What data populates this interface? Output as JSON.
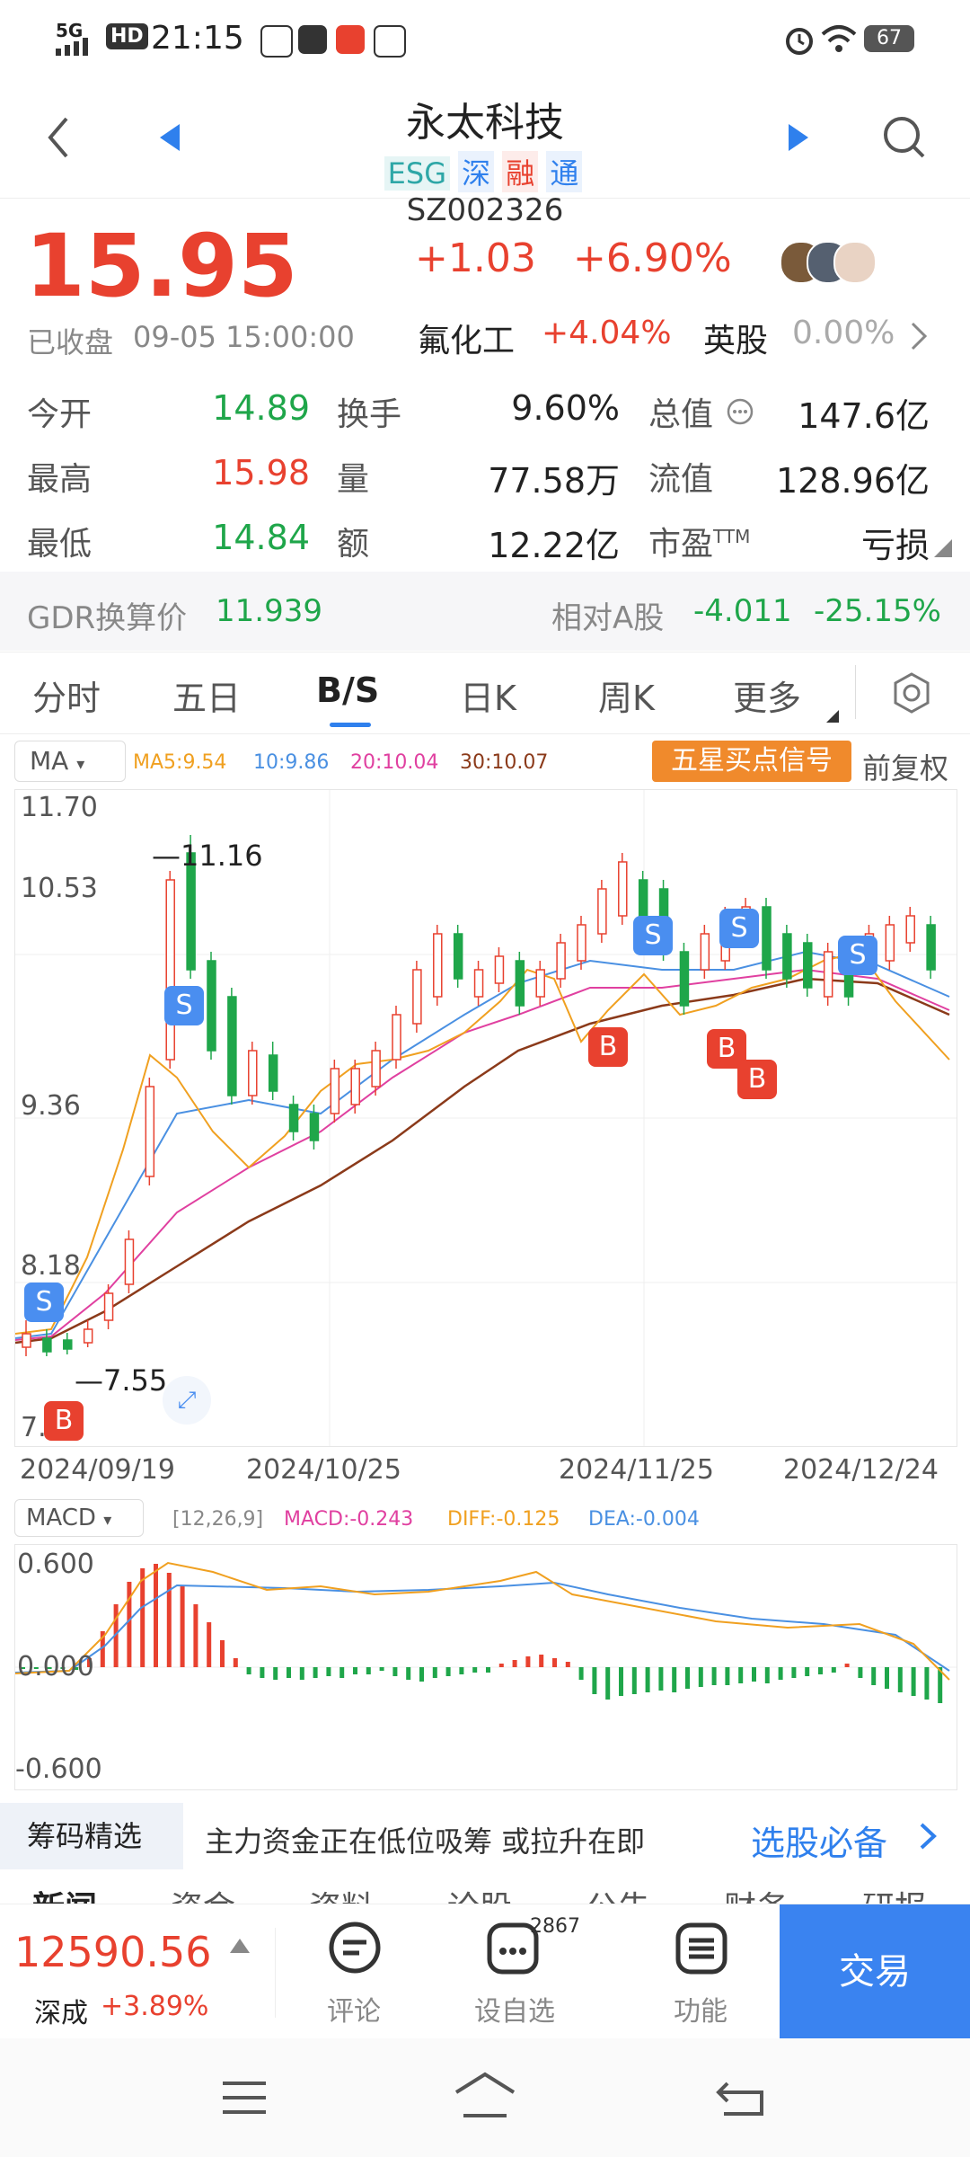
{
  "status": {
    "signal": "5G",
    "hd": "HD",
    "time": "21:15",
    "battery": "67"
  },
  "header": {
    "title": "永太科技",
    "tags": [
      "ESG",
      "深",
      "融",
      "通"
    ],
    "code": "SZ002326"
  },
  "quote": {
    "price": "15.95",
    "change": "+1.03",
    "change_pct": "+6.90%",
    "state": "已收盘",
    "datetime": "09-05  15:00:00",
    "sector_name": "氟化工",
    "sector_pct": "+4.04%",
    "uk_label": "英股",
    "uk_pct": "0.00%"
  },
  "metrics": {
    "open_label": "今开",
    "open": "14.89",
    "high_label": "最高",
    "high": "15.98",
    "low_label": "最低",
    "low": "14.84",
    "turnover_label": "换手",
    "turnover": "9.60%",
    "volume_label": "量",
    "volume": "77.58万",
    "amount_label": "额",
    "amount": "12.22亿",
    "mcap_label": "总值",
    "mcap": "147.6亿",
    "float_label": "流值",
    "float": "128.96亿",
    "pe_label": "市盈",
    "pe_sup": "TTM",
    "pe": "亏损"
  },
  "gdr": {
    "label": "GDR换算价",
    "value": "11.939",
    "rel_label": "相对A股",
    "rel_value": "-4.011",
    "rel_pct": "-25.15%"
  },
  "tabs": [
    "分时",
    "五日",
    "B/S",
    "日K",
    "周K",
    "更多"
  ],
  "active_tab": "B/S",
  "kline": {
    "indicator": "MA",
    "ma5": "MA5:9.54",
    "ma10": "10:9.86",
    "ma20": "20:10.04",
    "ma30": "30:10.07",
    "signal_btn": "五星买点信号",
    "adjust": "前复权",
    "y_labels": [
      "11.70",
      "10.53",
      "9.36",
      "8.18",
      "7.01"
    ],
    "x_labels": [
      "2024/09/19",
      "2024/10/25",
      "2024/11/25",
      "2024/12/24"
    ],
    "max_label": "11.16",
    "min_label": "7.55"
  },
  "macd": {
    "indicator": "MACD",
    "params": "[12,26,9]",
    "macd": "MACD:-0.243",
    "diff": "DIFF:-0.125",
    "dea": "DEA:-0.004",
    "y_labels": [
      "0.600",
      "0.000",
      "-0.600"
    ]
  },
  "chips": {
    "label": "筹码精选",
    "text": "主力资金正在低位吸筹  或拉升在即",
    "link": "选股必备"
  },
  "subtabs": [
    "新闻",
    "资金",
    "资料",
    "论股",
    "公告",
    "财务",
    "研报"
  ],
  "bottom": {
    "index_value": "12590.56",
    "index_name": "深成",
    "index_pct": "+3.89%",
    "comment": "评论",
    "watch": "设自选",
    "watch_count": "2867",
    "func": "功能",
    "trade": "交易"
  },
  "colors": {
    "up": "#e8412f",
    "down": "#1fa64a",
    "accent": "#2f80ed",
    "signal": "#f08a2c"
  }
}
